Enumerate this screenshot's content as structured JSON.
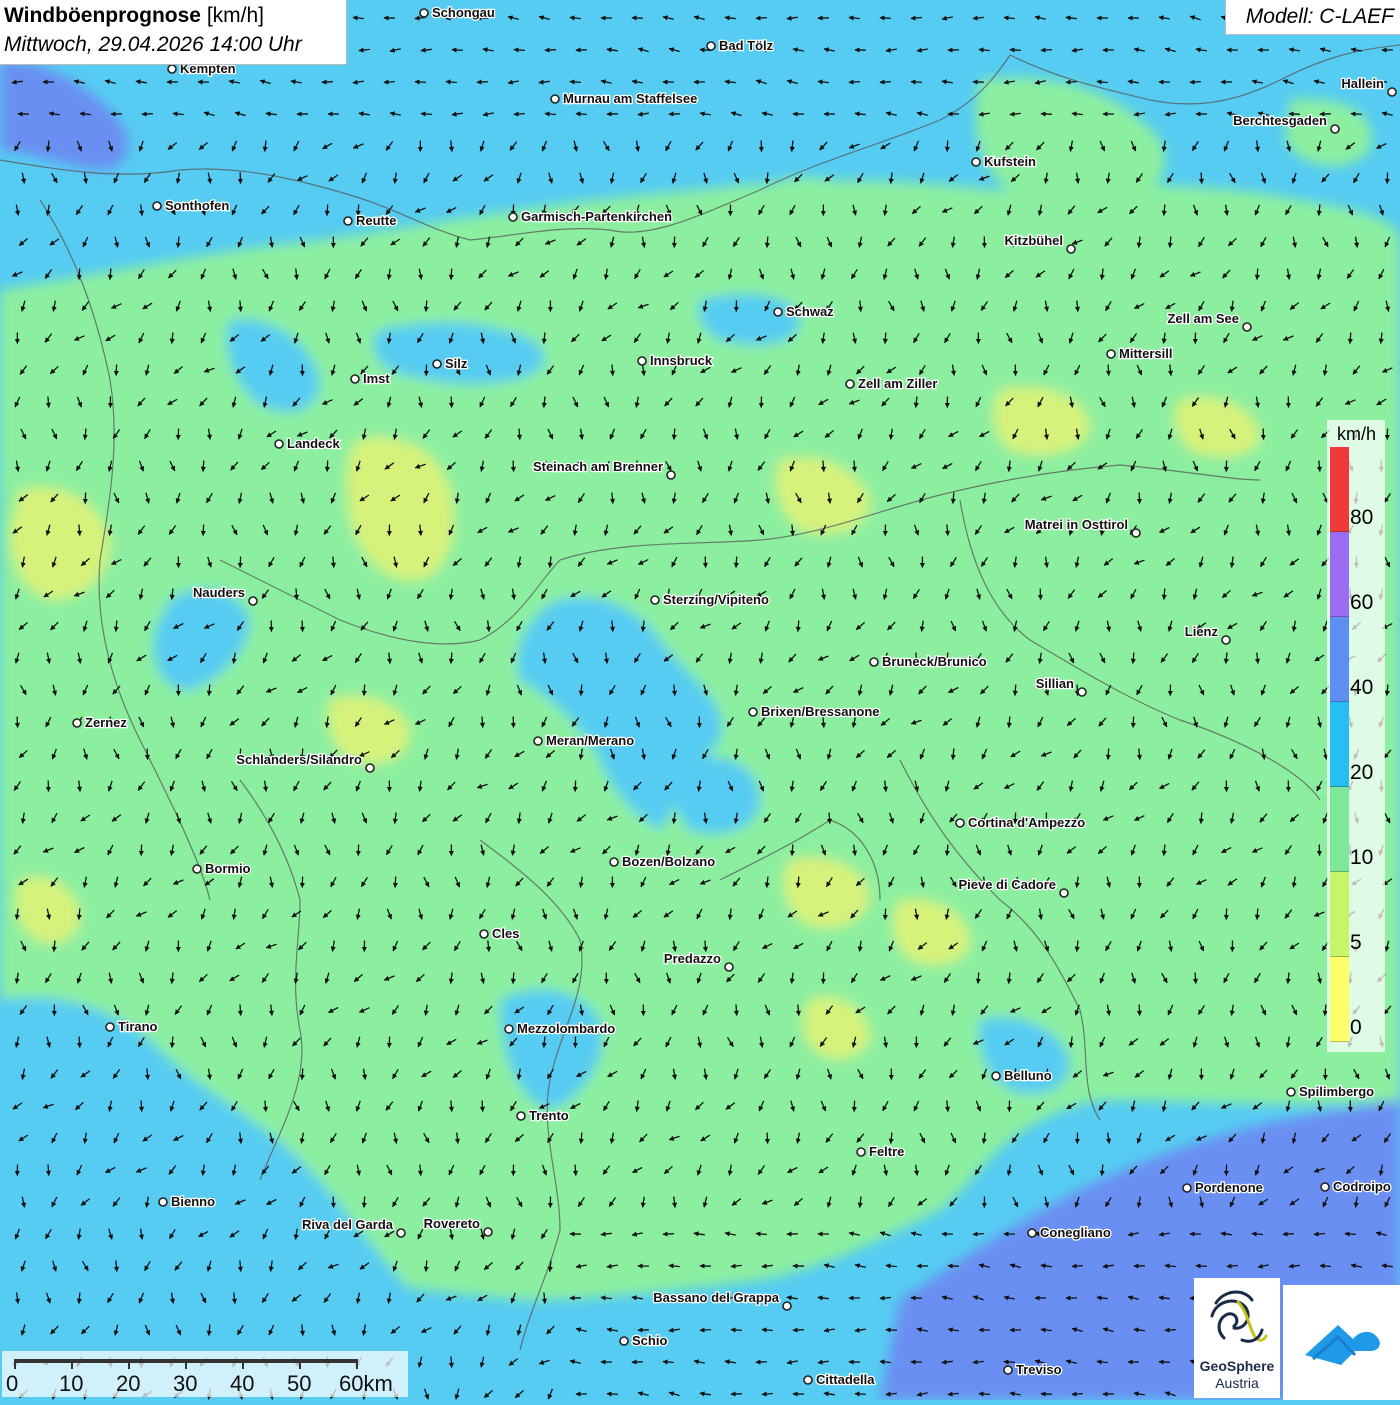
{
  "header": {
    "title": "Windböenprognose",
    "unit": "[km/h]",
    "datetime": "Mittwoch, 29.04.2026 14:00 Uhr"
  },
  "model": {
    "label": "Modell: C-LAEF"
  },
  "legend": {
    "unit": "km/h",
    "labels": [
      "80",
      "60",
      "40",
      "20",
      "10",
      "5",
      "0"
    ],
    "colors": [
      "#f03a3a",
      "#9b6cf2",
      "#5d8ff2",
      "#27bff2",
      "#7ee89a",
      "#c6f56a",
      "#ffff6a"
    ]
  },
  "scale": {
    "labels": [
      "0",
      "10",
      "20",
      "30",
      "40",
      "50",
      "60km"
    ]
  },
  "logo": {
    "name": "GeoSphere",
    "sub": "Austria",
    "icons": [
      "geosphere-logo-icon",
      "weather-app-icon"
    ]
  },
  "background_colors": {
    "calm": "#8cefa0",
    "light": "#d7f27a",
    "breezy": "#56ccf2",
    "windy": "#6a8ff2"
  },
  "places": [
    {
      "name": "Schongau"
    },
    {
      "name": "Bad Tölz"
    },
    {
      "name": "Kempten"
    },
    {
      "name": "Murnau am Staffelsee"
    },
    {
      "name": "Hallein"
    },
    {
      "name": "Berchtesgaden"
    },
    {
      "name": "Kufstein"
    },
    {
      "name": "Sonthofen"
    },
    {
      "name": "Reutte"
    },
    {
      "name": "Garmisch-Partenkirchen"
    },
    {
      "name": "Kitzbühel"
    },
    {
      "name": "Schwaz"
    },
    {
      "name": "Zell am See"
    },
    {
      "name": "Mittersill"
    },
    {
      "name": "Silz"
    },
    {
      "name": "Innsbruck"
    },
    {
      "name": "Imst"
    },
    {
      "name": "Zell am Ziller"
    },
    {
      "name": "Landeck"
    },
    {
      "name": "Steinach am Brenner"
    },
    {
      "name": "Matrei in Osttirol"
    },
    {
      "name": "Nauders"
    },
    {
      "name": "Sterzing/Vipiteno"
    },
    {
      "name": "Lienz"
    },
    {
      "name": "Bruneck/Brunico"
    },
    {
      "name": "Sillian"
    },
    {
      "name": "Brixen/Bressanone"
    },
    {
      "name": "Zernez"
    },
    {
      "name": "Meran/Merano"
    },
    {
      "name": "Schlanders/Silandro"
    },
    {
      "name": "Cortina d'Ampezzo"
    },
    {
      "name": "Bozen/Bolzano"
    },
    {
      "name": "Bormio"
    },
    {
      "name": "Pieve di Cadore"
    },
    {
      "name": "Cles"
    },
    {
      "name": "Predazzo"
    },
    {
      "name": "Tirano"
    },
    {
      "name": "Mezzolombardo"
    },
    {
      "name": "Belluno"
    },
    {
      "name": "Spilimbergo"
    },
    {
      "name": "Trento"
    },
    {
      "name": "Feltre"
    },
    {
      "name": "Pordenone"
    },
    {
      "name": "Codroipo"
    },
    {
      "name": "Bienno"
    },
    {
      "name": "Riva del Garda"
    },
    {
      "name": "Rovereto"
    },
    {
      "name": "Conegliano"
    },
    {
      "name": "Bassano del Grappa"
    },
    {
      "name": "Schio"
    },
    {
      "name": "Treviso"
    },
    {
      "name": "Cittadella"
    }
  ]
}
